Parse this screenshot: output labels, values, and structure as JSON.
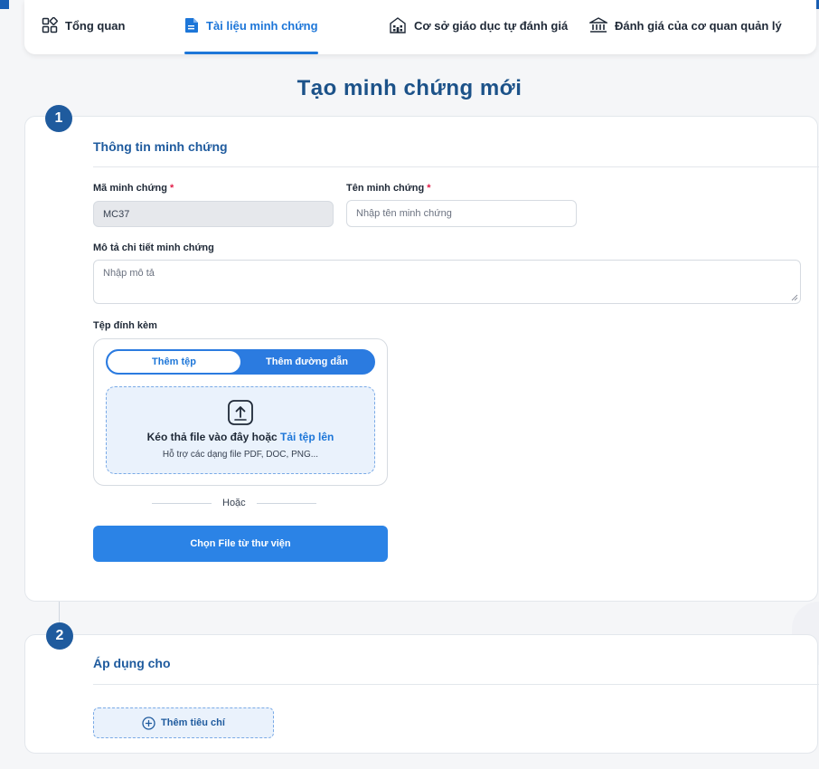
{
  "nav": {
    "tabs": [
      {
        "label": "Tổng quan",
        "icon": "grid-icon"
      },
      {
        "label": "Tài liệu minh chứng",
        "icon": "document-icon"
      },
      {
        "label": "Cơ sở giáo dục tự đánh giá",
        "icon": "school-icon"
      },
      {
        "label": "Đánh giá của cơ quan quản lý",
        "icon": "institution-icon"
      }
    ],
    "active_index": 1,
    "accent_color": "#1d76d8"
  },
  "page": {
    "title": "Tạo minh chứng mới"
  },
  "section1": {
    "step": "1",
    "title": "Thông tin minh chứng",
    "code": {
      "label": "Mã minh chứng",
      "required": "*",
      "value": "MC37"
    },
    "name": {
      "label": "Tên minh chứng",
      "required": "*",
      "placeholder": "Nhập tên minh chứng"
    },
    "description": {
      "label": "Mô tả chi tiết minh chứng",
      "placeholder": "Nhập mô tả"
    },
    "attachment": {
      "label": "Tệp đính kèm",
      "toggle": [
        "Thêm tệp",
        "Thêm đường dẫn"
      ],
      "drop_text": "Kéo thả file vào đây hoặc",
      "drop_link": "Tải tệp lên",
      "drop_hint": "Hỗ trợ các dạng file PDF, DOC, PNG...",
      "upload_icon": "upload-icon"
    },
    "or_text": "Hoặc",
    "library_button": "Chọn File từ thư viện"
  },
  "section2": {
    "step": "2",
    "title": "Áp dụng cho",
    "add_button": "Thêm tiêu chí",
    "add_icon": "plus-circle-icon"
  }
}
